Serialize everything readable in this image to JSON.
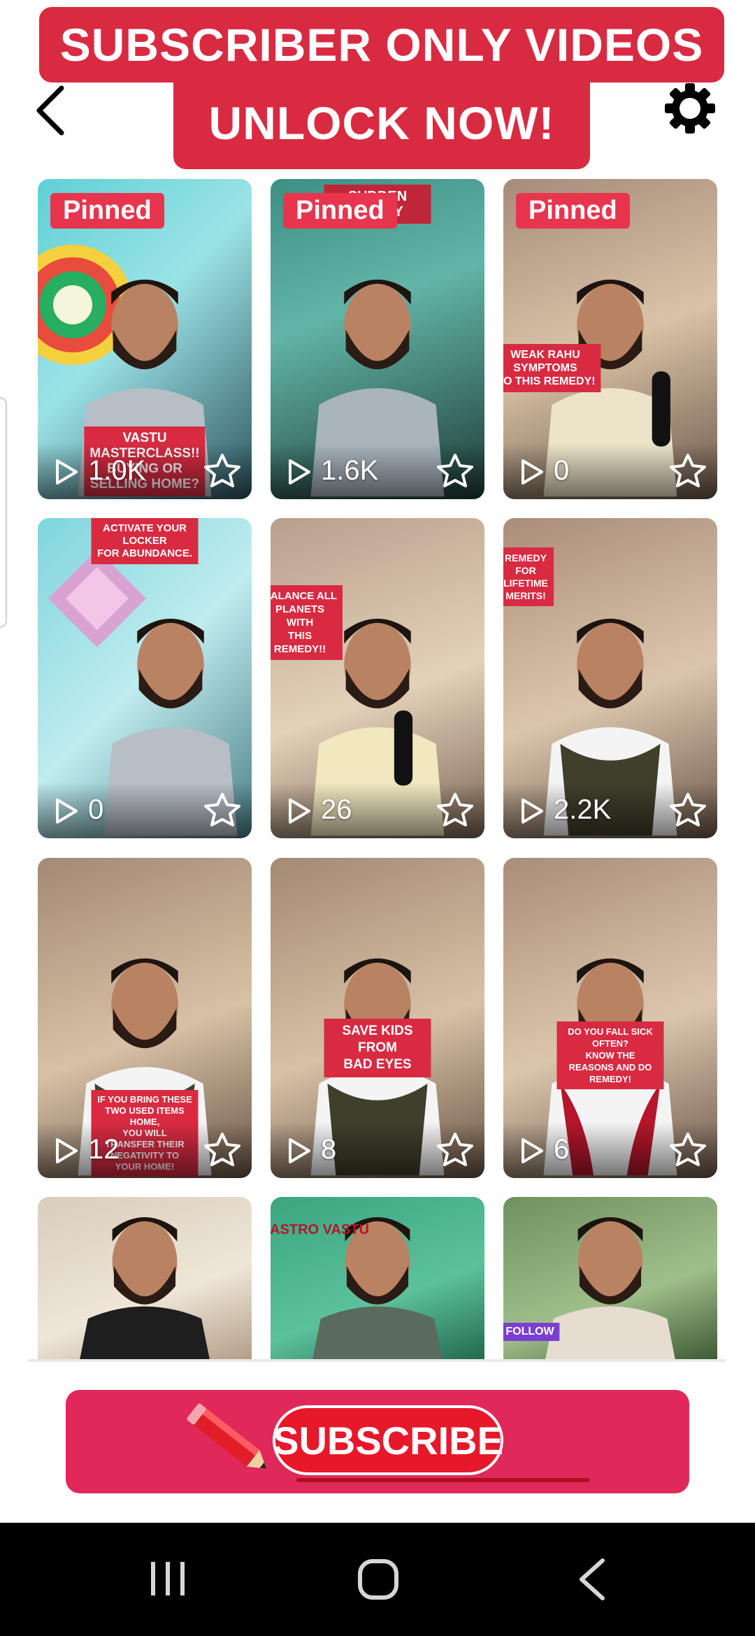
{
  "banner": {
    "line1": "SUBSCRIBER ONLY VIDEOS",
    "line2": "UNLOCK NOW!"
  },
  "header": {
    "back_icon": "chevron-left-icon",
    "settings_icon": "gear-icon"
  },
  "videos": [
    {
      "pinned": "Pinned",
      "views": "1.0K",
      "caption": "VASTU MASTERCLASS!!\nBUYING OR SELLING HOME?"
    },
    {
      "pinned": "Pinned",
      "views": "1.6K",
      "caption": "SUDDEN MONEY"
    },
    {
      "pinned": "Pinned",
      "views": "0",
      "caption": "WEAK RAHU\nSYMPTOMS\nDO THIS REMEDY!"
    },
    {
      "pinned": "",
      "views": "0",
      "caption": "ACTIVATE YOUR LOCKER\nFOR ABUNDANCE."
    },
    {
      "pinned": "",
      "views": "26",
      "caption": "BALANCE ALL\nPLANETS\nWITH\nTHIS\nREMEDY!!"
    },
    {
      "pinned": "",
      "views": "2.2K",
      "caption": "REMEDY\nFOR\nLIFETIME\nMERITS!"
    },
    {
      "pinned": "",
      "views": "12",
      "caption": "IF YOU BRING THESE\nTWO USED ITEMS HOME,\nYOU WILL TRANSFER THEIR\nNEGATIVITY TO YOUR HOME!"
    },
    {
      "pinned": "",
      "views": "8",
      "caption": "SAVE KIDS FROM\nBAD EYES"
    },
    {
      "pinned": "",
      "views": "6",
      "caption": "DO YOU FALL SICK OFTEN?\nKNOW THE REASONS AND DO REMEDY!"
    },
    {
      "pinned": "",
      "views": "",
      "caption": ""
    },
    {
      "pinned": "",
      "views": "",
      "caption": "ASTRO VASTU"
    },
    {
      "pinned": "",
      "views": "",
      "caption": "FOLLOW"
    }
  ],
  "subscribe": {
    "label": "SUBSCRIBE"
  },
  "colors": {
    "banner_red": "#d82b42",
    "pinned_badge": "#e8354e",
    "subscribe_bg": "#e0295a",
    "navbar": "#000000"
  },
  "navbar": {
    "recents_icon": "recents-icon",
    "home_icon": "home-icon",
    "back_icon": "back-icon"
  }
}
